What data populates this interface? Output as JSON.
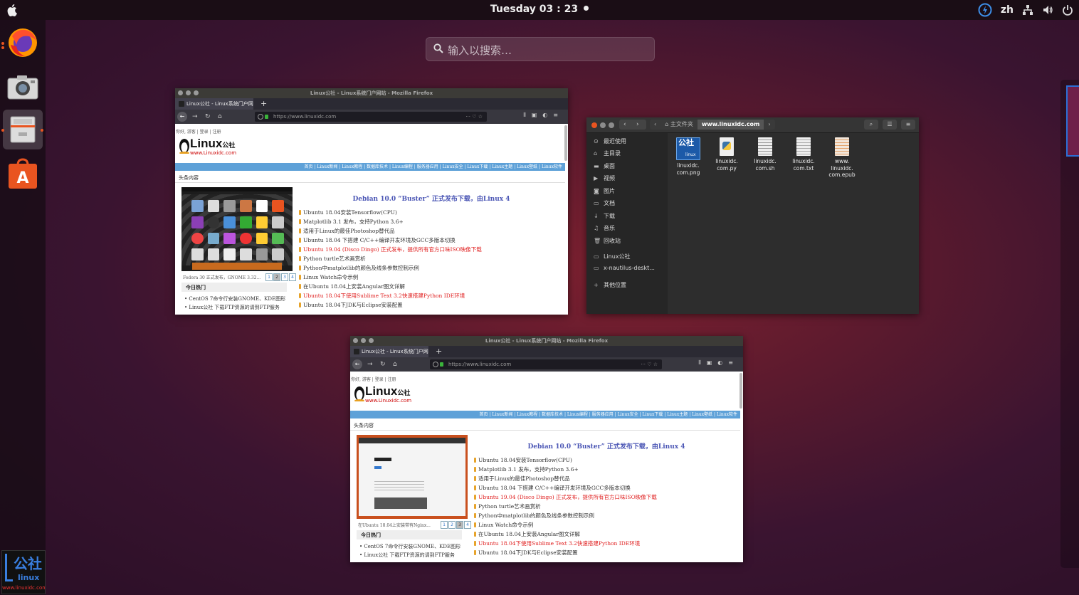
{
  "topbar": {
    "clock": "Tuesday 03 : 23",
    "lang": "zh"
  },
  "dock": {
    "items": [
      {
        "name": "firefox-icon"
      },
      {
        "name": "screenshot-camera-icon"
      },
      {
        "name": "file-manager-icon"
      },
      {
        "name": "software-center-icon"
      }
    ],
    "logo": {
      "gong": "公社",
      "linux": "linux",
      "site": "www.linuxidc.com"
    }
  },
  "search": {
    "placeholder": "输入以搜索…"
  },
  "firefox_win": {
    "title": "Linux公社 - Linux系统门户网站 - Mozilla Firefox",
    "tab": "Linux公社 - Linux系统门户网",
    "url": "https://www.linuxidc.com",
    "toplinks": "你好, 游客 | 登录 | 注册",
    "logo": "Linux",
    "logo_gong": "公社",
    "logo_sub": "www.Linuxidc.com",
    "nav": "首页 | Linux新闻 | Linux教程 | 数据库技术 | Linux编程 | 服务器应用 | Linux安全 | Linux下载 | Linux主题 | Linux壁纸 | Linux软件",
    "section": "头条内容",
    "headline": "Debian 10.0 “Buster” 正式发布下载，由Linux 4",
    "news": [
      "Ubuntu 18.04安装Tensorflow(CPU)",
      "Matplotlib 3.1 发布，支持Python 3.6+",
      "适用于Linux的最佳Photoshop替代品",
      "Ubuntu 18.04 下搭建 C/C++编译开发环境及GCC多版本切换",
      "Ubuntu 19.04 (Disco Dingo) 正式发布，提供所有官方口味ISO映像下载",
      "Python turtle艺术画赏析",
      "Python中matplotlib的颜色及线条参数控制示例",
      "Linux Watch命令示例",
      "在Ubuntu 18.04上安装Angular图文详解",
      "Ubuntu 18.04下使用Sublime Text 3.2快速搭建Python IDE环境",
      "Ubuntu 18.04下JDK与Eclipse安装配置"
    ],
    "news_red": [
      4,
      9
    ],
    "caption1": "Fedora 30 正式发布，GNOME 3.32...",
    "caption2": "在Ubuntu 18.04上安装带有Nginx...",
    "pager": [
      "1",
      "2",
      "3",
      "4"
    ],
    "today": "今日热门",
    "hot": [
      "• CentOS 7命令行安装GNOME、KDE图形",
      "• Linux公社 下载FTP资源的请到FTP服务"
    ]
  },
  "nautilus": {
    "path_home": "主文件夹",
    "path_current": "www.linuxidc.com",
    "sidebar": [
      {
        "icon": "recent-icon",
        "glyph": "⊙",
        "label": "最近使用"
      },
      {
        "icon": "home-icon",
        "glyph": "⌂",
        "label": "主目录"
      },
      {
        "icon": "desktop-icon",
        "glyph": "▬",
        "label": "桌面"
      },
      {
        "icon": "video-icon",
        "glyph": "▶",
        "label": "视频"
      },
      {
        "icon": "pictures-icon",
        "glyph": "◙",
        "label": "图片"
      },
      {
        "icon": "documents-icon",
        "glyph": "▭",
        "label": "文档"
      },
      {
        "icon": "downloads-icon",
        "glyph": "↓",
        "label": "下载"
      },
      {
        "icon": "music-icon",
        "glyph": "♫",
        "label": "音乐"
      },
      {
        "icon": "trash-icon",
        "glyph": "🗑",
        "label": "回收站"
      },
      {
        "icon": "folder-icon",
        "glyph": "▭",
        "label": "Linux公社"
      },
      {
        "icon": "desktop-file-icon",
        "glyph": "▭",
        "label": "x-nautilus-deskt..."
      },
      {
        "icon": "plus-icon",
        "glyph": "+",
        "label": "其他位置"
      }
    ],
    "files": [
      {
        "label": "linuxidc.\ncom.png",
        "icon": "image-file-icon"
      },
      {
        "label": "linuxidc.\ncom.py",
        "icon": "python-file-icon"
      },
      {
        "label": "linuxidc.\ncom.sh",
        "icon": "script-file-icon"
      },
      {
        "label": "linuxidc.\ncom.txt",
        "icon": "text-file-icon"
      },
      {
        "label": "www.\nlinuxidc.\ncom.epub",
        "icon": "epub-file-icon"
      }
    ]
  },
  "colors": {
    "ubuntu_orange": "#e95420",
    "accent_blue": "#2c6fd6"
  }
}
